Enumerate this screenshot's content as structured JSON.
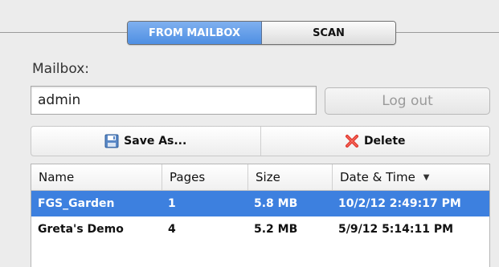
{
  "mode_tabs": [
    {
      "label": "FROM MAILBOX",
      "active": true
    },
    {
      "label": "SCAN",
      "active": false
    }
  ],
  "mailbox": {
    "label": "Mailbox:",
    "value": "admin",
    "logout_label": "Log out"
  },
  "toolbar": {
    "save_as_label": "Save As...",
    "delete_label": "Delete"
  },
  "table": {
    "columns": [
      "Name",
      "Pages",
      "Size",
      "Date & Time"
    ],
    "sort_indicator": "▼",
    "rows": [
      {
        "name": "FGS_Garden",
        "pages": "1",
        "size": "5.8 MB",
        "datetime": "10/2/12 2:49:17 PM",
        "selected": true
      },
      {
        "name": "Greta's Demo",
        "pages": "4",
        "size": "5.2 MB",
        "datetime": "5/9/12 5:14:11 PM",
        "selected": false
      }
    ]
  },
  "colors": {
    "accent": "#4f8fe3",
    "selection": "#3d80df",
    "delete_red": "#e0352b"
  },
  "icons": {
    "save": "floppy-disk-icon",
    "delete": "red-x-icon"
  }
}
